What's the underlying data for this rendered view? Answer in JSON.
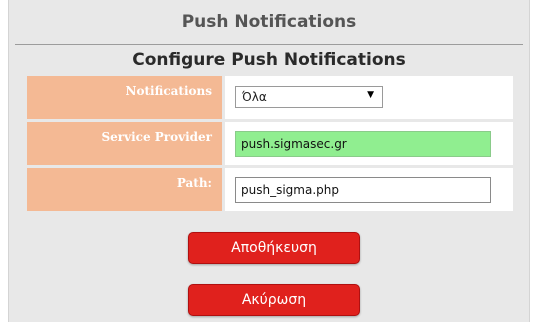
{
  "header": {
    "title": "Push Notifications",
    "subtitle": "Configure Push Notifications"
  },
  "form": {
    "rows": [
      {
        "label": "Notifications",
        "value": "Όλα",
        "type": "select"
      },
      {
        "label": "Service Provider",
        "value": "push.sigmasec.gr",
        "type": "text",
        "highlight": "#90ee90"
      },
      {
        "label": "Path:",
        "value": "push_sigma.php",
        "type": "text"
      }
    ]
  },
  "buttons": {
    "save_label": "Αποθήκευση",
    "cancel_label": "Ακύρωση"
  },
  "colors": {
    "label_bg": "#f4b994",
    "button_bg": "#e0211d",
    "highlight_input": "#90ee90"
  }
}
